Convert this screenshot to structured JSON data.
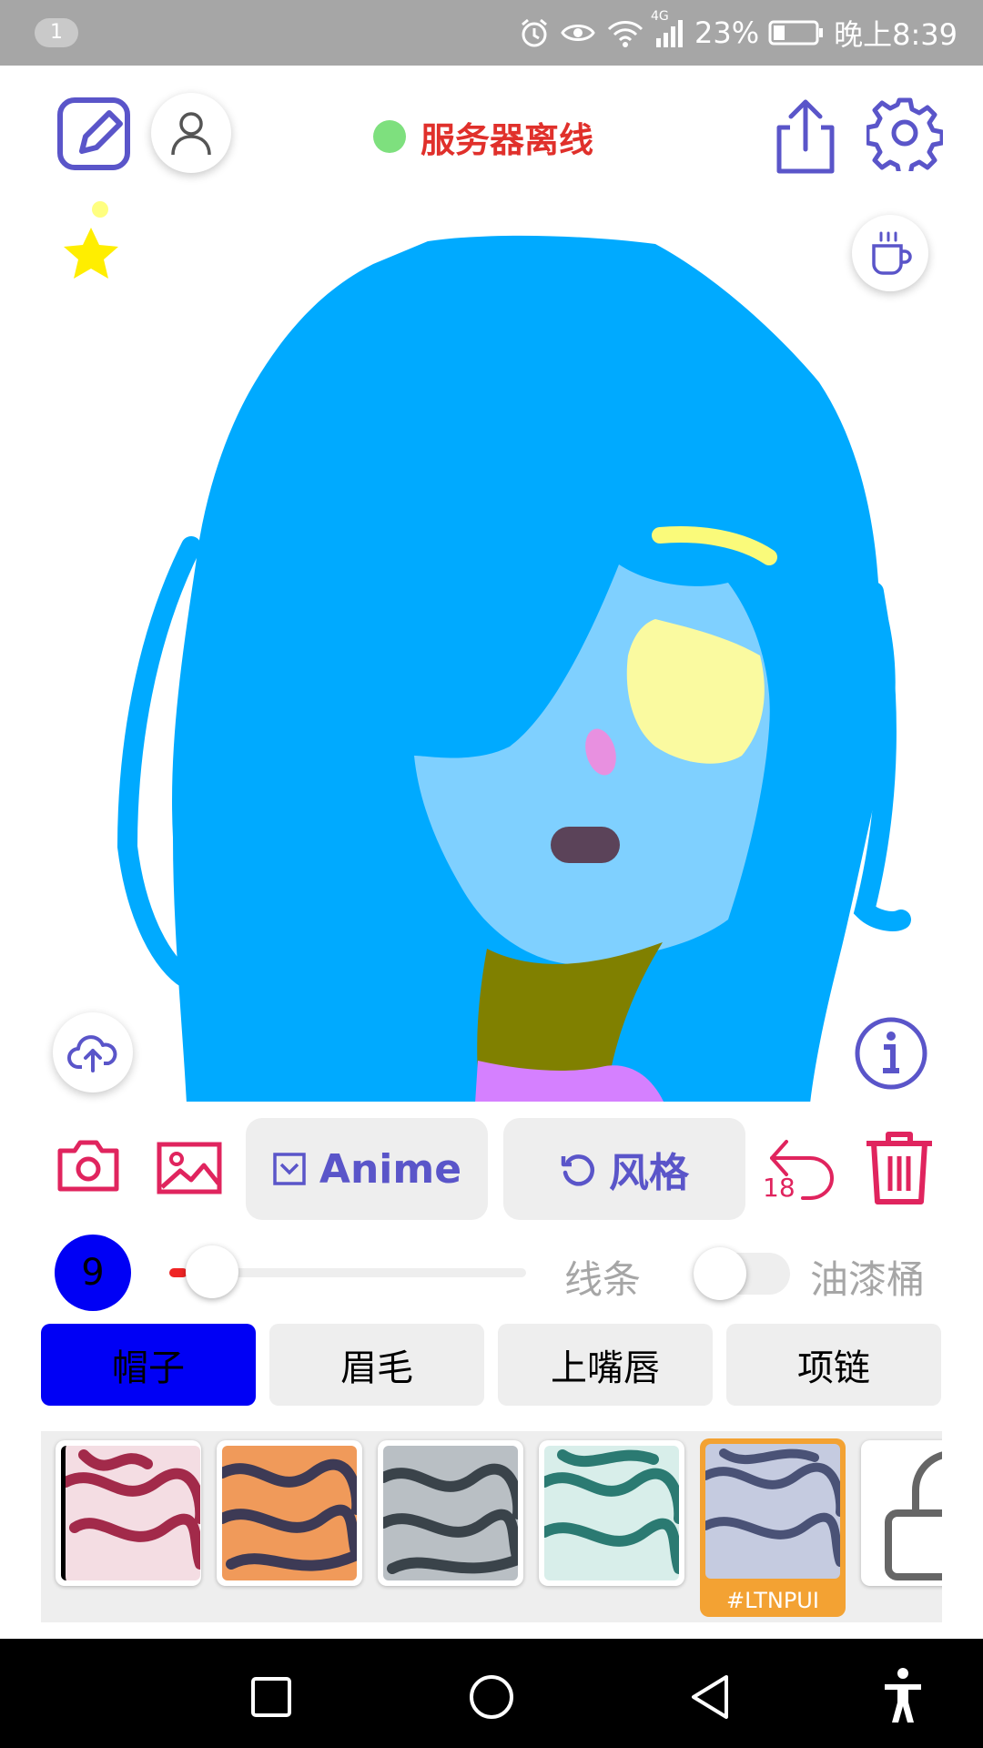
{
  "status_bar": {
    "notification_count": "1",
    "network_type": "4G",
    "battery_percent": "23%",
    "time": "晚上8:39",
    "icons": [
      "alarm-icon",
      "eye-icon",
      "wifi-icon",
      "signal-icon",
      "battery-icon"
    ]
  },
  "header": {
    "server_status": "服务器离线",
    "server_status_color": "#e0302b",
    "status_dot_color": "#7ee07e",
    "icons": [
      "edit-icon",
      "user-icon",
      "share-icon",
      "settings-icon",
      "star-icon",
      "coffee-icon"
    ]
  },
  "canvas": {
    "icons": [
      "cloud-upload-icon",
      "info-icon"
    ]
  },
  "actions": {
    "anime_label": "Anime",
    "style_label": "风格",
    "undo_count": "18",
    "icons": [
      "camera-icon",
      "image-icon",
      "checkbox-icon",
      "rotate-icon",
      "undo-icon",
      "trash-icon"
    ]
  },
  "brush": {
    "size": "9",
    "size_slider_level": 0.04,
    "line_label": "线条",
    "bucket_label": "油漆桶",
    "bucket_enabled": false
  },
  "parts": {
    "tabs": [
      {
        "label": "帽子",
        "active": true
      },
      {
        "label": "眉毛",
        "active": false
      },
      {
        "label": "上嘴唇",
        "active": false
      },
      {
        "label": "项链",
        "active": false
      }
    ]
  },
  "styles": {
    "selected_code": "#LTNPUI",
    "icons": [
      "lock-icon"
    ]
  },
  "nav": {
    "icons": [
      "recent-apps-icon",
      "home-icon",
      "back-icon",
      "accessibility-icon"
    ]
  },
  "colors": {
    "accent": "#5a55c9",
    "pink": "#e0245e",
    "active_tab": "#0000f5",
    "selected_tile": "#f3a233"
  }
}
